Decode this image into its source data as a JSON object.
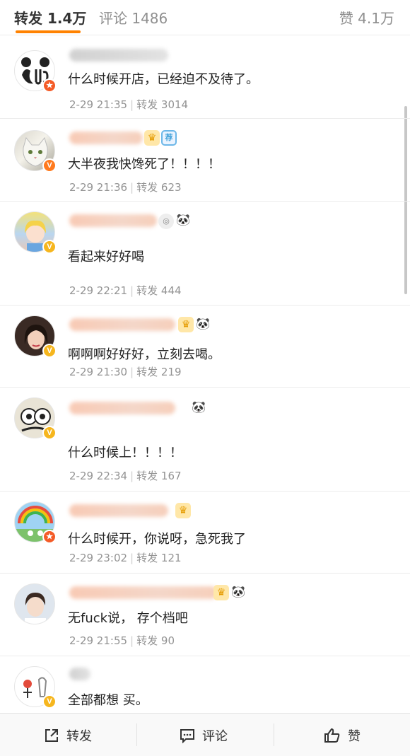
{
  "tabs": {
    "repost": "转发 1.4万",
    "comment": "评论 1486",
    "like": "赞 4.1万"
  },
  "accent_color": "#ff8200",
  "items": [
    {
      "text": "什么时候开店，已经迫不及待了。",
      "time": "2-29 21:35",
      "repost_label": "转发",
      "repost_count": "3014"
    },
    {
      "text": "大半夜我快馋死了！！！！",
      "time": "2-29 21:36",
      "repost_label": "转发",
      "repost_count": "623"
    },
    {
      "text": "看起来好好喝",
      "time": "2-29 22:21",
      "repost_label": "转发",
      "repost_count": "444"
    },
    {
      "text": "啊啊啊好好好，立刻去喝。",
      "time": "2-29 21:30",
      "repost_label": "转发",
      "repost_count": "219"
    },
    {
      "text": "什么时候上！！！！",
      "time": "2-29 22:34",
      "repost_label": "转发",
      "repost_count": "167"
    },
    {
      "text": "什么时候开，你说呀，急死我了",
      "time": "2-29 23:02",
      "repost_label": "转发",
      "repost_count": "121"
    },
    {
      "text": "无fuck说， 存个档吧",
      "time": "2-29 21:55",
      "repost_label": "转发",
      "repost_count": "90"
    },
    {
      "text": "全部都想 买。",
      "time": "",
      "repost_label": "",
      "repost_count": ""
    }
  ],
  "bottom": {
    "repost": "转发",
    "comment": "评论",
    "like": "赞"
  }
}
